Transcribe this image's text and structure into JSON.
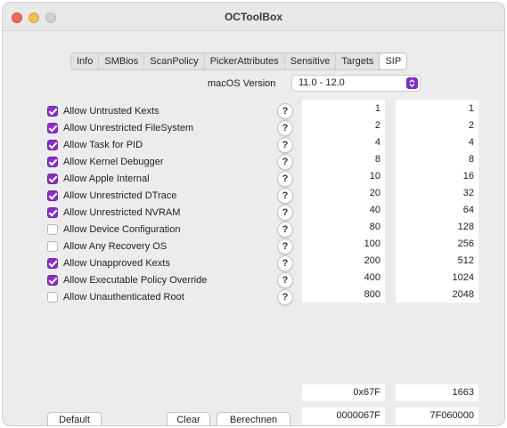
{
  "window": {
    "title": "OCToolBox"
  },
  "tabs": [
    "Info",
    "SMBios",
    "ScanPolicy",
    "PickerAttributes",
    "Sensitive",
    "Targets",
    "SIP"
  ],
  "active_tab": "SIP",
  "macos_version": {
    "label": "macOS Version",
    "value": "11.0 - 12.0"
  },
  "rows": [
    {
      "label": "Allow Untrusted Kexts",
      "checked": true,
      "hex": "1",
      "dec": "1"
    },
    {
      "label": "Allow Unrestricted FileSystem",
      "checked": true,
      "hex": "2",
      "dec": "2"
    },
    {
      "label": "Allow Task for PID",
      "checked": true,
      "hex": "4",
      "dec": "4"
    },
    {
      "label": "Allow Kernel Debugger",
      "checked": true,
      "hex": "8",
      "dec": "8"
    },
    {
      "label": "Allow Apple Internal",
      "checked": true,
      "hex": "10",
      "dec": "16"
    },
    {
      "label": "Allow Unrestricted DTrace",
      "checked": true,
      "hex": "20",
      "dec": "32"
    },
    {
      "label": "Allow Unrestricted NVRAM",
      "checked": true,
      "hex": "40",
      "dec": "64"
    },
    {
      "label": "Allow Device Configuration",
      "checked": false,
      "hex": "80",
      "dec": "128"
    },
    {
      "label": "Allow Any Recovery OS",
      "checked": false,
      "hex": "100",
      "dec": "256"
    },
    {
      "label": "Allow Unapproved Kexts",
      "checked": true,
      "hex": "200",
      "dec": "512"
    },
    {
      "label": "Allow Executable Policy Override",
      "checked": true,
      "hex": "400",
      "dec": "1024"
    },
    {
      "label": "Allow Unauthenticated Root",
      "checked": false,
      "hex": "800",
      "dec": "2048"
    }
  ],
  "help_symbol": "?",
  "totals": {
    "hex": "0x67F",
    "dec": "1663",
    "hex_padded": "0000067F",
    "le_bytes": "7F060000"
  },
  "buttons": {
    "default": "Default",
    "clear": "Clear",
    "calculate": "Berechnen"
  },
  "colors": {
    "accent": "#8a2fc8",
    "window_bg": "#ececec"
  }
}
